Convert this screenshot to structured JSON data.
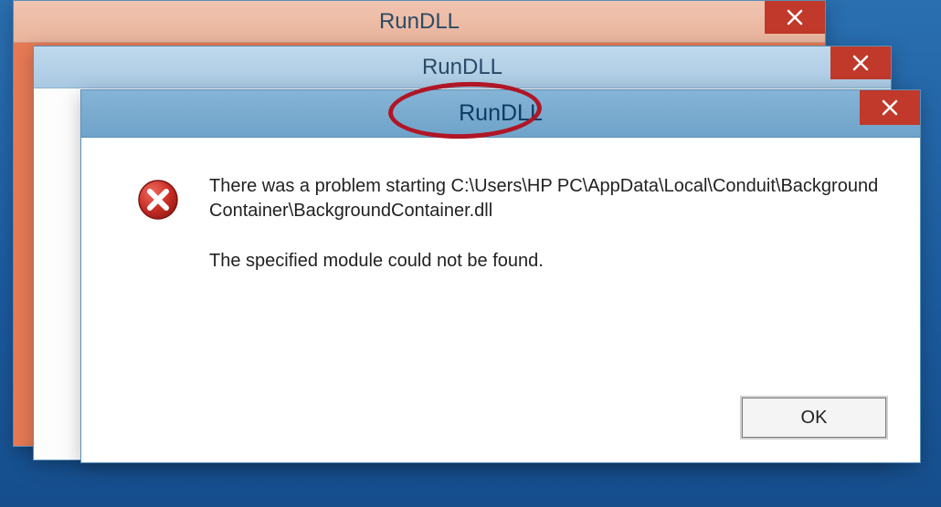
{
  "dialogs": {
    "back": {
      "title": "RunDLL"
    },
    "middle": {
      "title": "RunDLL"
    },
    "front": {
      "title": "RunDLL",
      "error_line1": "There was a problem starting C:\\Users\\HP PC\\AppData\\Local\\Conduit\\BackgroundContainer\\BackgroundContainer.dll",
      "error_line2": "The specified module could not be found.",
      "ok_label": "OK"
    }
  },
  "colors": {
    "close_bg": "#c0392b",
    "annotation": "#b01626",
    "desktop_top": "#2a6fb0"
  }
}
